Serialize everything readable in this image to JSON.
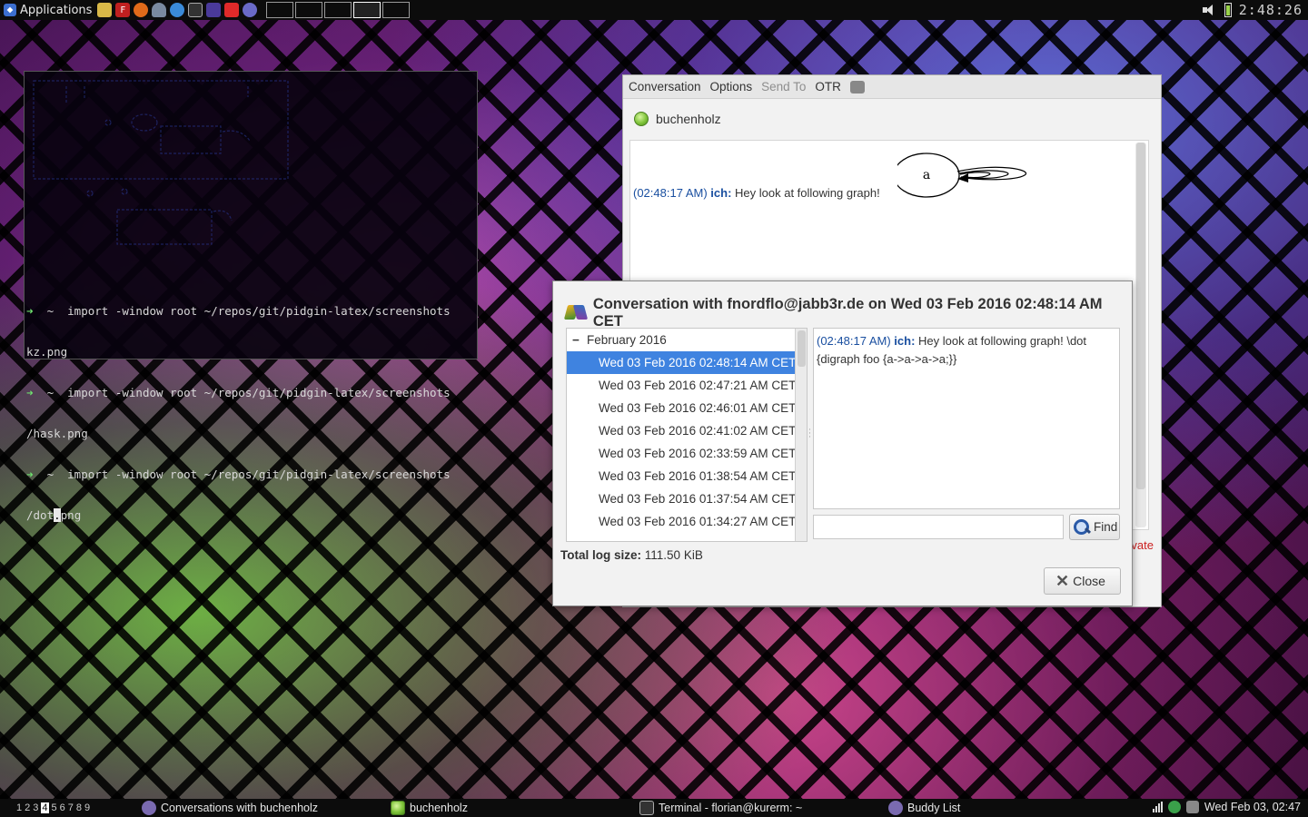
{
  "top_panel": {
    "applications_label": "Applications",
    "launcher_icons": [
      "folder-icon",
      "filezilla-icon",
      "firefox-icon",
      "cloud-icon",
      "chromium-icon",
      "terminal-icon",
      "screen-icon",
      "opera-icon",
      "browser-icon"
    ],
    "workspace_count": 5,
    "active_workspace_index": 3,
    "clock": "2:48:26"
  },
  "terminal": {
    "lines": [
      {
        "prompt": "➜",
        "text": "  ~  import -window root ~/repos/git/pidgin-latex/screenshots"
      },
      {
        "prompt": "",
        "text": "kz.png"
      },
      {
        "prompt": "➜",
        "text": "  ~  import -window root ~/repos/git/pidgin-latex/screenshots"
      },
      {
        "prompt": "",
        "text": "/hask.png"
      },
      {
        "prompt": "➜",
        "text": "  ~  import -window root ~/repos/git/pidgin-latex/screenshots"
      }
    ],
    "last_line_before_cursor": "/dot",
    "cursor_char": ".",
    "last_line_after_cursor": "png"
  },
  "conversation_window": {
    "menu": [
      {
        "label": "Conversation",
        "enabled": true
      },
      {
        "label": "Options",
        "enabled": true
      },
      {
        "label": "Send To",
        "enabled": false
      },
      {
        "label": "OTR",
        "enabled": true
      }
    ],
    "buddy_name": "buchenholz",
    "message": {
      "timestamp": "(02:48:17 AM)",
      "nick": "ich:",
      "text": "Hey look at following graph!"
    },
    "graph_node_label": "a",
    "status_fragment": "vate"
  },
  "log_dialog": {
    "title": "Conversation with fnordflo@jabb3r.de on Wed 03 Feb 2016 02:48:14 AM CET",
    "group": {
      "expander": "−",
      "label": "February 2016"
    },
    "entries": [
      "Wed 03 Feb 2016 02:48:14 AM CET",
      "Wed 03 Feb 2016 02:47:21 AM CET",
      "Wed 03 Feb 2016 02:46:01 AM CET",
      "Wed 03 Feb 2016 02:41:02 AM CET",
      "Wed 03 Feb 2016 02:33:59 AM CET",
      "Wed 03 Feb 2016 01:38:54 AM CET",
      "Wed 03 Feb 2016 01:37:54 AM CET",
      "Wed 03 Feb 2016 01:34:27 AM CET"
    ],
    "selected_index": 0,
    "log_message": {
      "timestamp": "(02:48:17 AM)",
      "nick": "ich:",
      "text": "Hey look at following graph! \\dot {digraph foo {a->a->a->a;}}"
    },
    "search_value": "",
    "find_label": "Find",
    "total_size_label": "Total log size:",
    "total_size_value": "111.50 KiB",
    "close_label": "Close"
  },
  "taskbar": {
    "pager": [
      "1",
      "2",
      "3",
      "4",
      "5",
      "6",
      "7",
      "8",
      "9"
    ],
    "current_desktop": "4",
    "tasks": [
      {
        "label": "Conversations with buchenholz",
        "icon": "pidgin-icon"
      },
      {
        "label": "buchenholz",
        "icon": "available-status-icon"
      },
      {
        "label": "Terminal - florian@kurerm: ~",
        "icon": "terminal-icon"
      },
      {
        "label": "Buddy List",
        "icon": "pidgin-icon"
      }
    ],
    "clock": "Wed Feb 03, 02:47"
  },
  "colors": {
    "selection": "#3f83e0",
    "timestamp": "#1a4fa0",
    "prompt_arrow": "#6ee06e",
    "private_status": "#cc2020"
  }
}
